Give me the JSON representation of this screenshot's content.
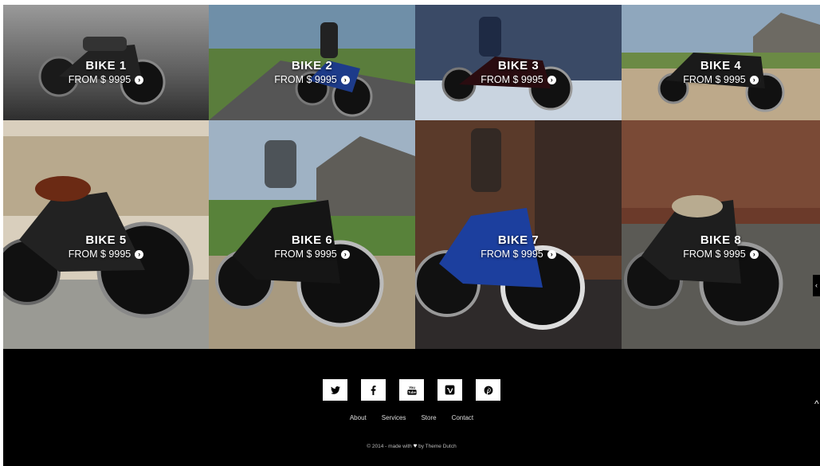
{
  "bikes": [
    {
      "title": "BIKE 1",
      "price": "FROM $ 9995"
    },
    {
      "title": "BIKE 2",
      "price": "FROM $ 9995"
    },
    {
      "title": "BIKE 3",
      "price": "FROM $ 9995"
    },
    {
      "title": "BIKE 4",
      "price": "FROM $ 9995"
    },
    {
      "title": "BIKE 5",
      "price": "FROM $ 9995"
    },
    {
      "title": "BIKE 6",
      "price": "FROM $ 9995"
    },
    {
      "title": "BIKE 7",
      "price": "FROM $ 9995"
    },
    {
      "title": "BIKE 8",
      "price": "FROM $ 9995"
    }
  ],
  "footer": {
    "socials": [
      "twitter-icon",
      "facebook-icon",
      "youtube-icon",
      "vimeo-icon",
      "pinterest-icon"
    ],
    "nav": [
      "About",
      "Services",
      "Store",
      "Contact"
    ],
    "copyright_prefix": "© 2014 - made with",
    "copyright_suffix": "by Theme Dutch"
  },
  "colors": {
    "footer_bg": "#000000",
    "icon_bg": "#ffffff"
  }
}
